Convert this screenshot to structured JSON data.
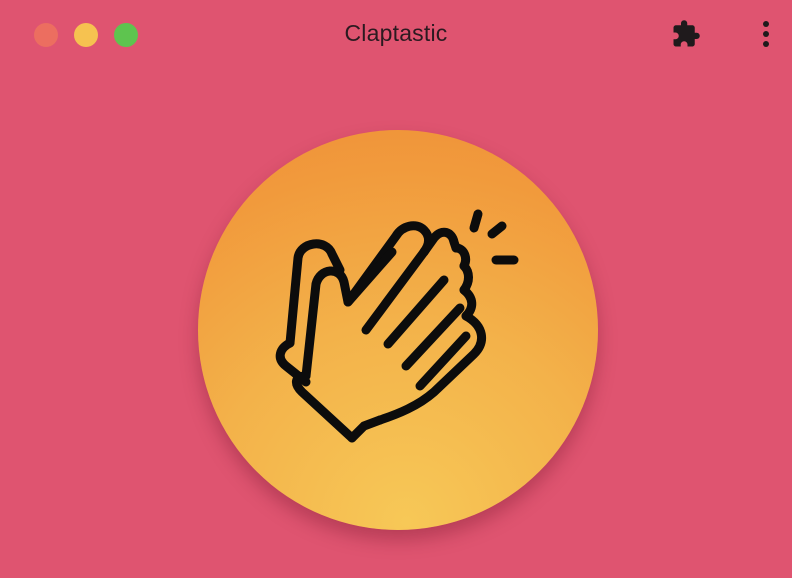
{
  "window": {
    "title": "Claptastic",
    "background": "#df5470"
  },
  "traffic_lights": {
    "close_color": "#ec6e60",
    "minimize_color": "#f6c250",
    "maximize_color": "#5ec44f"
  },
  "toolbar": {
    "extensions_icon": "puzzle-icon",
    "menu_icon": "kebab-menu-icon"
  },
  "main": {
    "clap_icon": "clapping-hands-icon",
    "button_gradient": [
      "#ef8f38",
      "#f7c857"
    ]
  }
}
